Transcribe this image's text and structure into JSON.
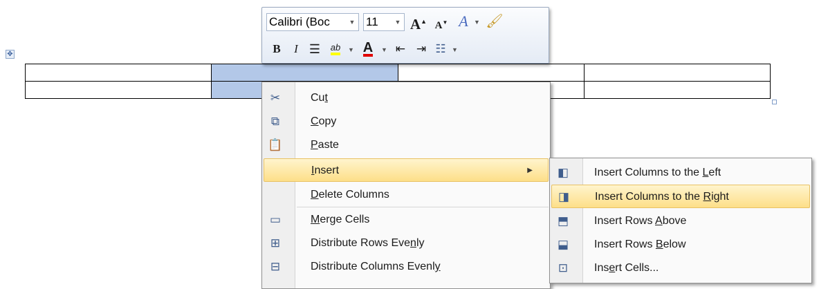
{
  "mini_toolbar": {
    "font_name": "Calibri (Boc",
    "font_size": "11",
    "grow_font_glyph": "A",
    "shrink_font_glyph": "A",
    "styles_glyph": "A",
    "bold": "B",
    "italic": "I",
    "highlight_glyph": "ab",
    "font_color_glyph": "A"
  },
  "context_menu": {
    "items": [
      {
        "pre": "Cu",
        "key": "t",
        "post": "",
        "icon": "scissors-icon"
      },
      {
        "pre": "",
        "key": "C",
        "post": "opy",
        "icon": "copy-icon"
      },
      {
        "pre": "",
        "key": "P",
        "post": "aste",
        "icon": "paste-icon"
      },
      {
        "pre": "",
        "key": "I",
        "post": "nsert",
        "icon": ""
      },
      {
        "pre": "",
        "key": "D",
        "post": "elete Columns",
        "icon": ""
      },
      {
        "pre": "",
        "key": "M",
        "post": "erge Cells",
        "icon": "merge-cells-icon"
      },
      {
        "pre": "Distribute Rows Eve",
        "key": "n",
        "post": "ly",
        "icon": "distribute-rows-icon"
      },
      {
        "pre": "Distribute Columns Evenl",
        "key": "y",
        "post": "",
        "icon": "distribute-columns-icon"
      }
    ]
  },
  "submenu": {
    "items": [
      {
        "pre": "Insert Columns to the ",
        "key": "L",
        "post": "eft",
        "icon": "insert-columns-left-icon"
      },
      {
        "pre": "Insert Columns to the ",
        "key": "R",
        "post": "ight",
        "icon": "insert-columns-right-icon"
      },
      {
        "pre": "Insert Rows ",
        "key": "A",
        "post": "bove",
        "icon": "insert-rows-above-icon"
      },
      {
        "pre": "Insert Rows ",
        "key": "B",
        "post": "elow",
        "icon": "insert-rows-below-icon"
      },
      {
        "pre": "Ins",
        "key": "e",
        "post": "rt Cells...",
        "icon": "insert-cells-icon"
      }
    ]
  }
}
